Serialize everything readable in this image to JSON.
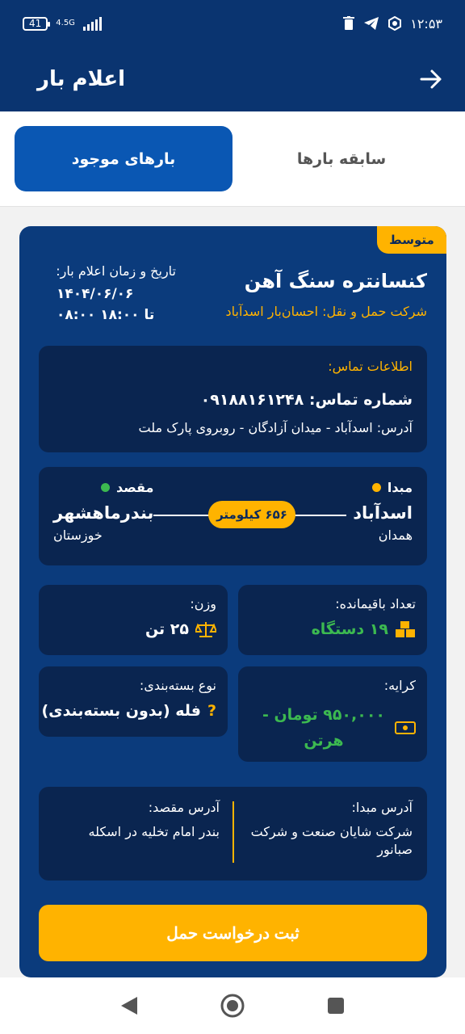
{
  "status_bar": {
    "time": "۱۲:۵۳",
    "battery": "41",
    "network": "4.5G"
  },
  "app_bar": {
    "title": "اعلام بار"
  },
  "tabs": [
    {
      "label": "سابقه بارها",
      "active": false
    },
    {
      "label": "بارهای موجود",
      "active": true
    }
  ],
  "card": {
    "badge": "متوسط",
    "title": "کنسانتره سنگ آهن",
    "company": "شرکت حمل و نقل: احسان‌بار اسدآباد",
    "date_label": "تاریخ و زمان اعلام بار:",
    "date": "۱۴۰۴/۰۶/۰۶",
    "time_range": "۰۸:۰۰ تا ۱۸:۰۰",
    "contact": {
      "label": "اطلاعات تماس:",
      "phone": "شماره تماس: ۰۹۱۸۸۱۶۱۲۴۸",
      "address": "آدرس: اسدآباد - میدان آزادگان - روبروی پارک ملت"
    },
    "route": {
      "origin_label": "مبدا",
      "origin_city": "اسدآباد",
      "origin_province": "همدان",
      "dest_label": "مقصد",
      "dest_city": "بندرماهشهر",
      "dest_province": "خوزستان",
      "distance": "۶۵۶ کیلومتر"
    },
    "remaining": {
      "label": "تعداد باقیمانده:",
      "value": "۱۹ دستگاه"
    },
    "weight": {
      "label": "وزن:",
      "value": "۲۵ تن"
    },
    "fare": {
      "label": "کرایه:",
      "value": "۹۵۰,۰۰۰ تومان - هرتن"
    },
    "packaging": {
      "label": "نوع بسته‌بندی:",
      "value": "فله (بدون بسته‌بندی)"
    },
    "origin_address": {
      "label": "آدرس مبدا:",
      "value": "شرکت شایان صنعت و شرکت صبانور"
    },
    "dest_address": {
      "label": "آدرس مقصد:",
      "value": "بندر امام تخلیه در اسکله"
    },
    "submit_label": "ثبت درخواست حمل"
  },
  "colors": {
    "header": "#0a3470",
    "card": "#0b3b7c",
    "inner_box": "#0a2550",
    "accent": "#ffb300",
    "tab_active": "#0a57b3",
    "green": "#3cb950"
  }
}
